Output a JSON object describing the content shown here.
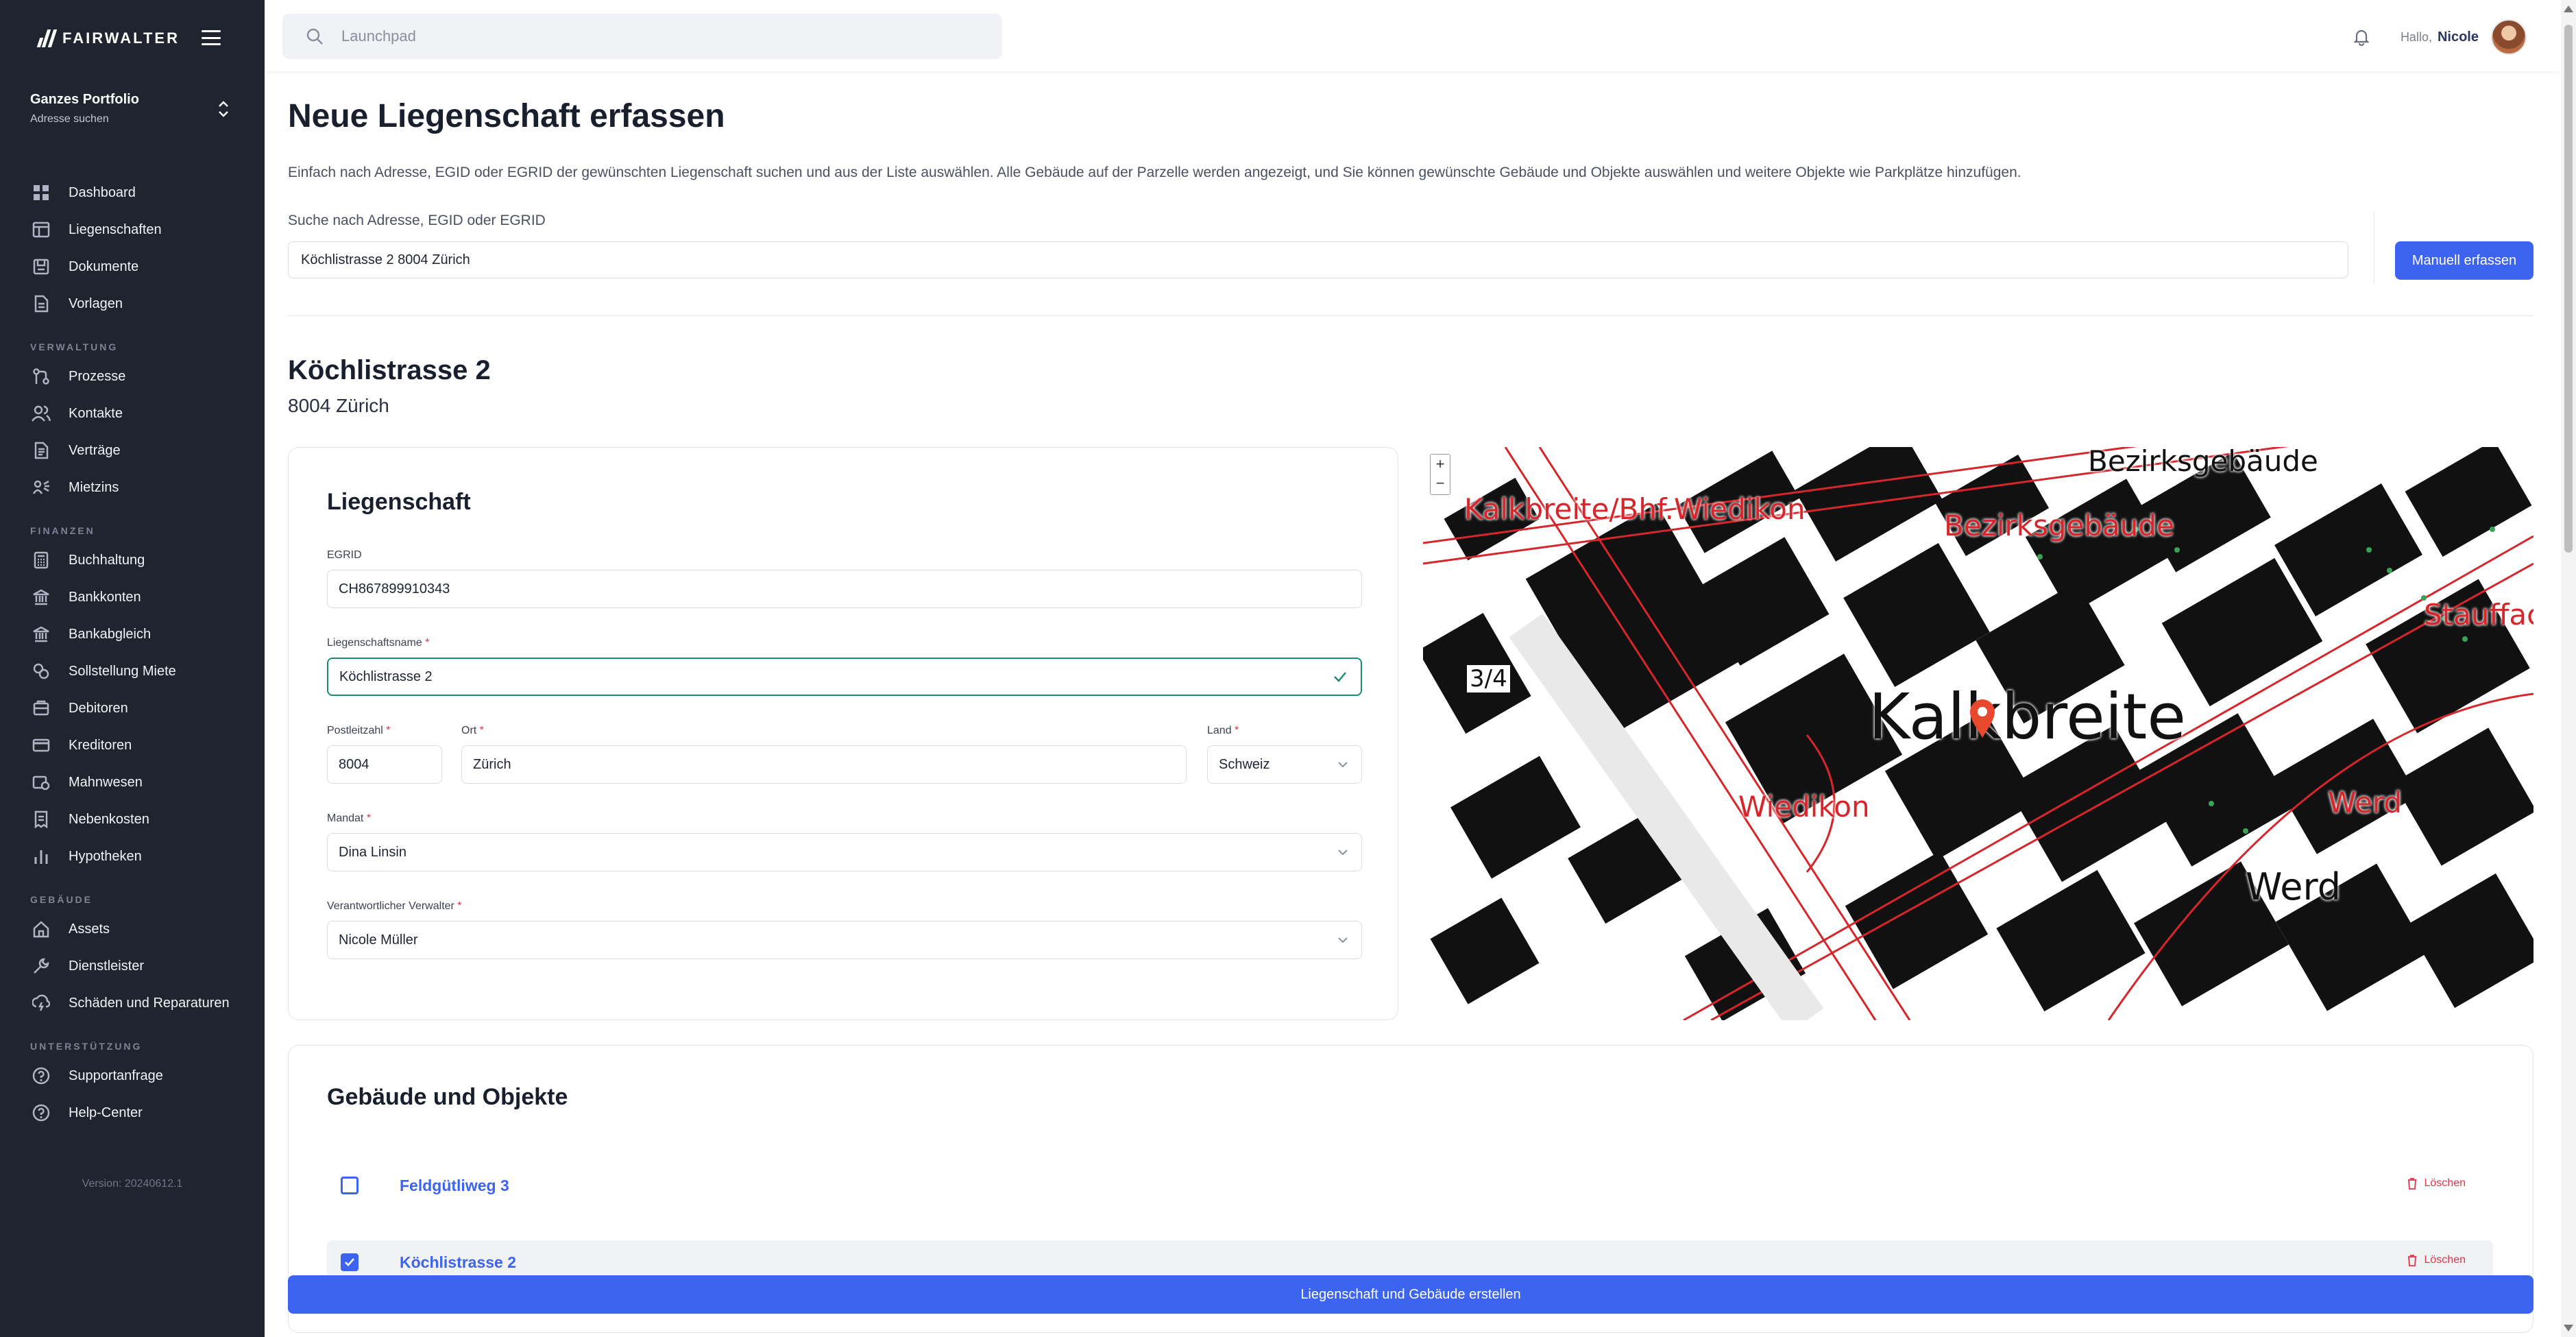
{
  "sidebar": {
    "brand": "FAIRWALTER",
    "portfolio": {
      "title": "Ganzes Portfolio",
      "subtitle": "Adresse suchen"
    },
    "main_items": [
      {
        "label": "Dashboard",
        "icon": "grid-icon"
      },
      {
        "label": "Liegenschaften",
        "icon": "layout-icon"
      },
      {
        "label": "Dokumente",
        "icon": "folder-icon"
      },
      {
        "label": "Vorlagen",
        "icon": "document-icon"
      }
    ],
    "sections": [
      {
        "title": "VERWALTUNG",
        "items": [
          {
            "label": "Prozesse",
            "icon": "process-icon"
          },
          {
            "label": "Kontakte",
            "icon": "users-icon"
          },
          {
            "label": "Verträge",
            "icon": "contract-icon"
          },
          {
            "label": "Mietzins",
            "icon": "rent-icon"
          }
        ]
      },
      {
        "title": "FINANZEN",
        "items": [
          {
            "label": "Buchhaltung",
            "icon": "calculator-icon"
          },
          {
            "label": "Bankkonten",
            "icon": "bank-icon"
          },
          {
            "label": "Bankabgleich",
            "icon": "bank-sync-icon"
          },
          {
            "label": "Sollstellung Miete",
            "icon": "coins-icon"
          },
          {
            "label": "Debitoren",
            "icon": "debtor-icon"
          },
          {
            "label": "Kreditoren",
            "icon": "card-icon"
          },
          {
            "label": "Mahnwesen",
            "icon": "reminder-icon"
          },
          {
            "label": "Nebenkosten",
            "icon": "receipt-icon"
          },
          {
            "label": "Hypotheken",
            "icon": "chart-icon"
          }
        ]
      },
      {
        "title": "GEBÄUDE",
        "items": [
          {
            "label": "Assets",
            "icon": "home-icon"
          },
          {
            "label": "Dienstleister",
            "icon": "wrench-icon"
          },
          {
            "label": "Schäden und Reparaturen",
            "icon": "damage-icon"
          }
        ]
      },
      {
        "title": "UNTERSTÜTZUNG",
        "items": [
          {
            "label": "Supportanfrage",
            "icon": "help-icon"
          },
          {
            "label": "Help-Center",
            "icon": "help-icon"
          }
        ]
      }
    ],
    "version": "Version: 20240612.1"
  },
  "topbar": {
    "search_placeholder": "Launchpad",
    "greeting": "Hallo,",
    "user": "Nicole"
  },
  "main": {
    "title": "Neue Liegenschaft erfassen",
    "description": "Einfach nach Adresse, EGID oder EGRID der gewünschten Liegenschaft suchen und aus der Liste auswählen. Alle Gebäude auf der Parzelle werden angezeigt, und Sie können gewünschte Gebäude und Objekte auswählen und weitere Objekte wie Parkplätze hinzufügen.",
    "search_label": "Suche nach Adresse, EGID oder EGRID",
    "search_value": "Köchlistrasse 2 8004 Zürich",
    "manual_button": "Manuell erfassen",
    "address_title": "Köchlistrasse 2",
    "address_subtitle": "8004 Zürich"
  },
  "form": {
    "title": "Liegenschaft",
    "egrid": {
      "label": "EGRID",
      "value": "CH867899910343"
    },
    "name": {
      "label": "Liegenschaftsname",
      "value": "Köchlistrasse 2"
    },
    "plz": {
      "label": "Postleitzahl",
      "value": "8004"
    },
    "ort": {
      "label": "Ort",
      "value": "Zürich"
    },
    "land": {
      "label": "Land",
      "value": "Schweiz"
    },
    "mandat": {
      "label": "Mandat",
      "value": "Dina Linsin"
    },
    "verwalter": {
      "label": "Verantwortlicher Verwalter",
      "value": "Nicole Müller"
    }
  },
  "map": {
    "labels": [
      "Kalkbreite/Bhf.Wiedikon",
      "Bezirksgebäude",
      "Bezirksgebäude",
      "Stauffach",
      "Kalkbreite",
      "Wiedikon",
      "Werd",
      "Werd",
      "3/4"
    ]
  },
  "buildings": {
    "title": "Gebäude und Objekte",
    "items": [
      {
        "name": "Feldgütliweg 3",
        "checked": false,
        "delete_label": "Löschen"
      },
      {
        "name": "Köchlistrasse 2",
        "checked": true,
        "delete_label": "Löschen"
      }
    ]
  },
  "footer": {
    "create_button": "Liegenschaft und Gebäude erstellen"
  },
  "colors": {
    "primary": "#3d64f0",
    "sidebar": "#20242f",
    "danger": "#e0344a",
    "valid": "#1c8c74"
  }
}
